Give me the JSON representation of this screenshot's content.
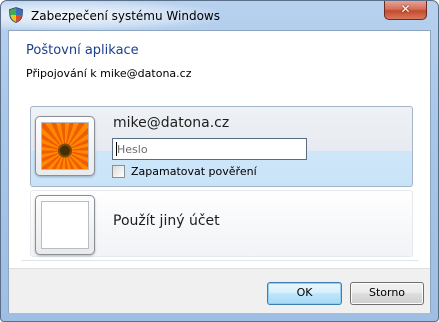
{
  "window": {
    "title": "Zabezpečení systému Windows",
    "close_glyph": "✕"
  },
  "dialog": {
    "caption": "Poštovní aplikace",
    "subcaption": "Připojování k mike@datona.cz"
  },
  "account": {
    "username": "mike@datona.cz",
    "password_placeholder": "Heslo",
    "password_value": "",
    "remember_label": "Zapamatovat pověření",
    "remember_checked": false,
    "picture_icon": "flower-user-picture-icon"
  },
  "other_account": {
    "label": "Použít jiný účet",
    "picture_icon": "blank-user-picture-icon"
  },
  "buttons": {
    "ok_label": "OK",
    "cancel_label": "Storno"
  },
  "colors": {
    "caption": "#1b3f8b",
    "title_bar": "#a8c6e8",
    "selected_tile": "#cfe6f8",
    "close_button": "#c44a2e",
    "ok_border": "#3c7fb1"
  }
}
